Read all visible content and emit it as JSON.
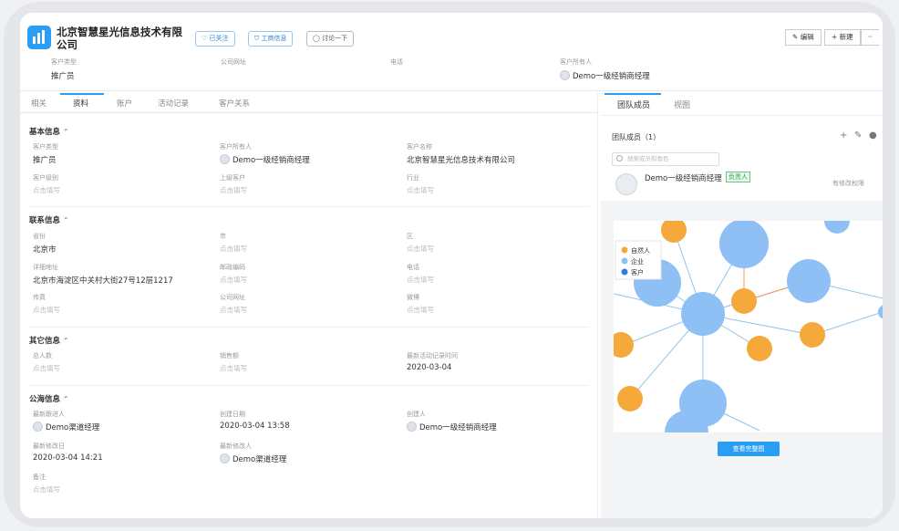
{
  "header": {
    "company_name": "北京智慧星光信息技术有限公司",
    "buttons": {
      "follow": "已关注",
      "business_info": "工商信息",
      "discuss": "讨论一下",
      "edit": "编辑",
      "new": "新建",
      "more": "··"
    },
    "fields": [
      {
        "label": "客户类型",
        "value": "推广员"
      },
      {
        "label": "公司网址",
        "value": ""
      },
      {
        "label": "电话",
        "value": ""
      },
      {
        "label": "客户所有人",
        "value": "Demo一级经销商经理"
      }
    ]
  },
  "tabs": [
    "相关",
    "资料",
    "账户",
    "活动记录",
    "客户关系"
  ],
  "placeholder": "点击填写",
  "sections": {
    "basic": {
      "title": "基本信息",
      "fields": [
        {
          "label": "客户类型",
          "value": "推广员"
        },
        {
          "label": "客户所有人",
          "value": "Demo一级经销商经理"
        },
        {
          "label": "客户名称",
          "value": "北京智慧星光信息技术有限公司"
        },
        {
          "label": "客户级别",
          "value": "点击填写"
        },
        {
          "label": "上级客户",
          "value": "点击填写"
        },
        {
          "label": "行业",
          "value": "点击填写"
        }
      ]
    },
    "contact": {
      "title": "联系信息",
      "fields": [
        {
          "label": "省份",
          "value": "北京市"
        },
        {
          "label": "市",
          "value": "点击填写"
        },
        {
          "label": "区",
          "value": "点击填写"
        },
        {
          "label": "详细地址",
          "value": "北京市海淀区中关村大街27号12层1217"
        },
        {
          "label": "邮政编码",
          "value": "点击填写"
        },
        {
          "label": "电话",
          "value": "点击填写"
        },
        {
          "label": "传真",
          "value": "点击填写"
        },
        {
          "label": "公司网址",
          "value": "点击填写"
        },
        {
          "label": "微博",
          "value": "点击填写"
        }
      ]
    },
    "other": {
      "title": "其它信息",
      "fields": [
        {
          "label": "总人数",
          "value": "点击填写"
        },
        {
          "label": "销售额",
          "value": "点击填写"
        },
        {
          "label": "最新活动记录时间",
          "value": "2020-03-04"
        }
      ]
    },
    "sea": {
      "title": "公海信息",
      "fields": [
        {
          "label": "最新跟进人",
          "value": "Demo渠道经理"
        },
        {
          "label": "创建日期",
          "value": "2020-03-04 13:58"
        },
        {
          "label": "创建人",
          "value": "Demo一级经销商经理"
        },
        {
          "label": "最新修改日",
          "value": "2020-03-04 14:21"
        },
        {
          "label": "最新修改人",
          "value": "Demo渠道经理"
        },
        {
          "label": "备注",
          "value": "点击填写"
        }
      ]
    }
  },
  "right": {
    "tabs": [
      "团队成员",
      "视图"
    ],
    "team_title": "团队成员（1）",
    "search_placeholder": "搜索成员和角色",
    "member": {
      "name": "Demo一级经销商经理",
      "badge": "负责人",
      "perm": "有修改权限"
    },
    "legend": [
      "自然人",
      "企业",
      "客户"
    ],
    "view_full": "查看完整图",
    "colors": {
      "person": "#f6a93b",
      "company": "#8ec0f5",
      "customer": "#2f7fe0"
    }
  }
}
